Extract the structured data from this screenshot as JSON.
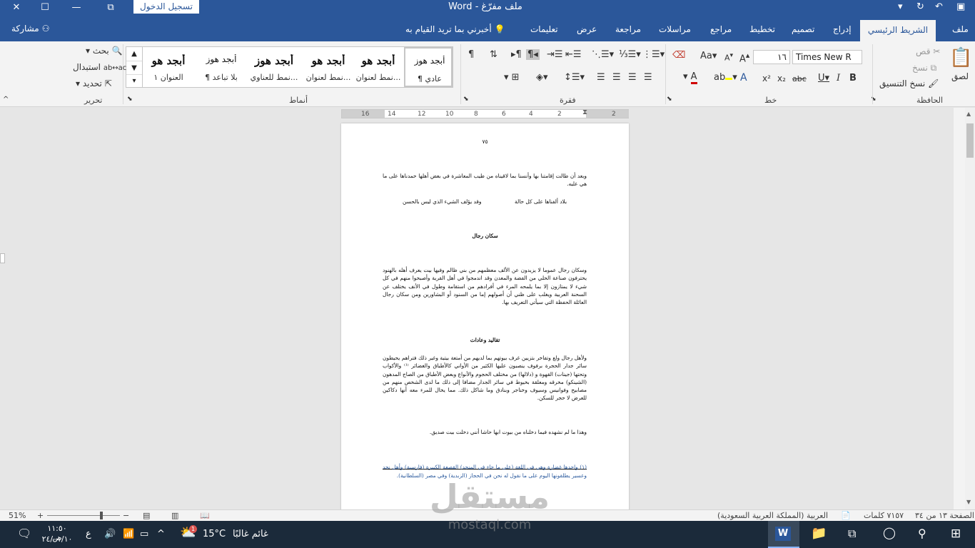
{
  "titlebar": {
    "signin": "تسجيل الدخول",
    "title": "ملف مفرّغ  -  Word"
  },
  "tabs": {
    "file": "ملف",
    "home": "الشريط الرئيسي",
    "insert": "إدراج",
    "design": "تصميم",
    "layout": "تخطيط",
    "references": "مراجع",
    "mailings": "مراسلات",
    "review": "مراجعة",
    "view": "عرض",
    "help": "تعليمات",
    "tellme": "أخبرني بما تريد القيام به",
    "share": "مشاركة"
  },
  "ribbon": {
    "clipboard": {
      "label": "الحافظة",
      "paste": "لصق",
      "cut": "قص",
      "copy": "نسخ",
      "format_painter": "نسخ التنسيق"
    },
    "font": {
      "label": "خط",
      "font_name": "Times New R",
      "font_size": "١٦"
    },
    "paragraph": {
      "label": "فقرة"
    },
    "styles": {
      "label": "أنماط",
      "items": [
        {
          "sample": "أبجد هوز",
          "name": "¶ عادي"
        },
        {
          "sample": "أبجد هو",
          "name": "نمط لعنوان..."
        },
        {
          "sample": "أبجد هو",
          "name": "نمط لعنوان..."
        },
        {
          "sample": "أبجد هوز",
          "name": "نمط للعناوي..."
        },
        {
          "sample": "أبجد هوز",
          "name": "¶ بلا تباعد"
        },
        {
          "sample": "أبجد هو",
          "name": "العنوان ١"
        }
      ]
    },
    "editing": {
      "label": "تحرير",
      "find": "بحث",
      "replace": "استبدال",
      "select": "تحديد"
    }
  },
  "ruler": {
    "ticks": [
      "2",
      "2",
      "4",
      "6",
      "8",
      "10",
      "12",
      "14",
      "16"
    ]
  },
  "document": {
    "page_number": "٧٥",
    "para1": "وبعد أن طالت إقامتنا بها وأنسنا بما لاقيناه من طيب المعاشرة في بعض أهلها حمدناها على ما هي عليه.",
    "verse_right": "بلاد ألفناها على كل حالة",
    "verse_left": "وقد يؤلف الشيء الذي ليس بالحسن",
    "heading1": "سكان رجال",
    "para2": "وسكان رجال عموما لا يزيدون عن الألف معظمهم من بني ظالم وفيها بيت يعرف أهله بالهنود يحترفون صناعة الحلي من الفضة والمعدن وقد اندمجوا في أهل القرية وأصبحوا منهم في كل شيء لا يمتازون إلا بما يلمحه المرء في أفرادهم من استقامة وطول في الأنف يختلف عن السحنة العربية ويغلب على ظني أن أصولهم إما من السنود أو البشاورين ومن سكان رجال العائلة الحفظة التي سيأتي التعريف بها.",
    "heading2": "تقاليد وعادات",
    "para3": "ولأهل رجال ولع وتفاخر بتزيين غرف بيوتهم بما لديهم من أمتعة بيتية وغير ذلك فتراهم يحيطون سائر جدار الحجرة برفوف ينصبون عليها الكثير من الأواني كالأطباق والغضائر ⁽¹⁾ والأكواب وتحتها (جينات) القهوة و (دلالها) من مختلف الحجوم والأنواع وبعض الأطباق من الصاج المدهون (الشينكو) مخرقه ومعلقة بخيوط في سائر الجدار مضافا إلى ذلك ما لدى الشخص منهم من مصابيح وفوانيس وسيوف وخناجر وبنادق وما شاكل ذلك. مما يخال للمرء معه أنها دكاكين للعرض لا حجر للسكن.",
    "para4": "وهذا ما لم نشهده فيما دخلناه من بيوت ابها حاشا أنني دخلت بيت صديق.",
    "footnote": "(١)    واحدها غضارة وهي في اللغة (على ما جاء في المنجد) القصعة الكبيرة (فارسية) وأهل نجد وعسير يطلقونها اليوم على ما نقول له نحن في الحجاز (الزبدية) وفي مصر (السلطانية)."
  },
  "statusbar": {
    "page": "الصفحة ١٣ من ٣٤",
    "words": "٧١٥٧ كلمات",
    "language": "العربية (المملكة العربية السعودية)",
    "zoom": "51%"
  },
  "taskbar": {
    "time": "١١:٥٠ ص",
    "date": "٢٤/٠١/١٠",
    "lang": "ع",
    "weather_temp": "15°C",
    "weather_text": "غائم غالبًا",
    "weather_badge": "1"
  },
  "watermark": {
    "arabic": "مستقل",
    "latin": "mostaql.com"
  }
}
